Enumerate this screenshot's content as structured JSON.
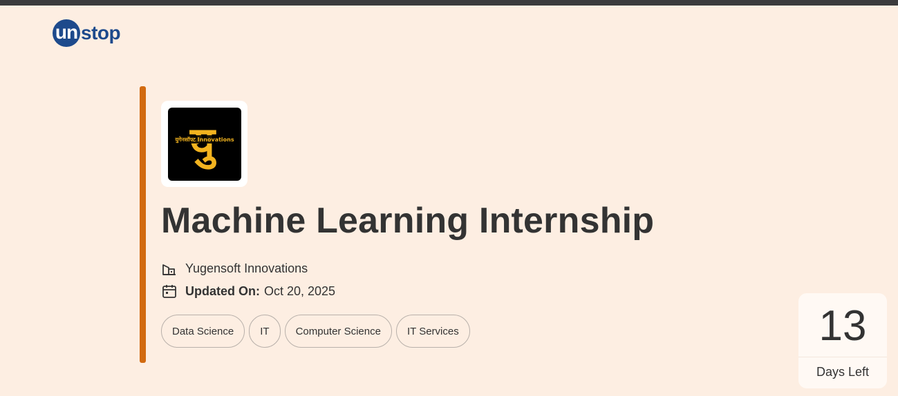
{
  "brand": {
    "logo_part1": "un",
    "logo_part2": "stop",
    "color": "#1d4a8c"
  },
  "company_logo": {
    "label": "युगेनसॉफ्ट Innovations",
    "glyph": "यु",
    "glyph_color": "#f2b31f"
  },
  "listing": {
    "title": "Machine Learning Internship",
    "company": "Yugensoft Innovations",
    "updated_label": "Updated On:",
    "updated_value": "Oct 20, 2025",
    "tags": [
      "Data Science",
      "IT",
      "Computer Science",
      "IT Services"
    ],
    "accent_color": "#d26a10"
  },
  "deadline": {
    "days": "13",
    "label": "Days Left"
  },
  "icons": {
    "company": "building-icon",
    "updated": "calendar-icon"
  }
}
